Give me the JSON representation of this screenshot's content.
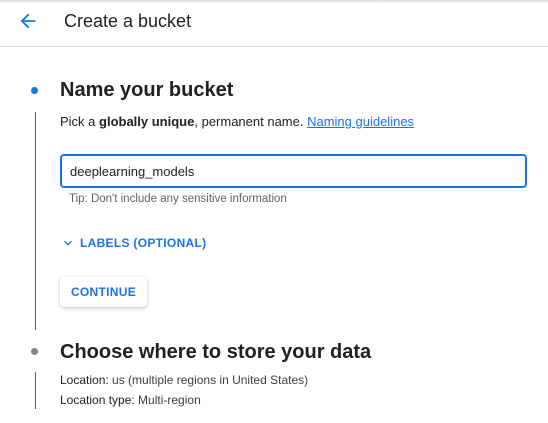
{
  "header": {
    "title": "Create a bucket",
    "back_icon": "arrow-left-icon"
  },
  "colors": {
    "accent": "#1a73e8",
    "inactive_step": "#80868b"
  },
  "step1": {
    "title": "Name your bucket",
    "desc_prefix": "Pick a ",
    "desc_bold": "globally unique",
    "desc_suffix": ", permanent name. ",
    "link": "Naming guidelines",
    "input_value": "deeplearning_models",
    "tip": "Tip: Don't include any sensitive information",
    "labels_toggle": "LABELS (OPTIONAL)",
    "continue": "CONTINUE"
  },
  "step2": {
    "title": "Choose where to store your data",
    "location_label": "Location:",
    "location_value": " us (multiple regions in United States)",
    "type_label": "Location type:",
    "type_value": " Multi-region"
  }
}
